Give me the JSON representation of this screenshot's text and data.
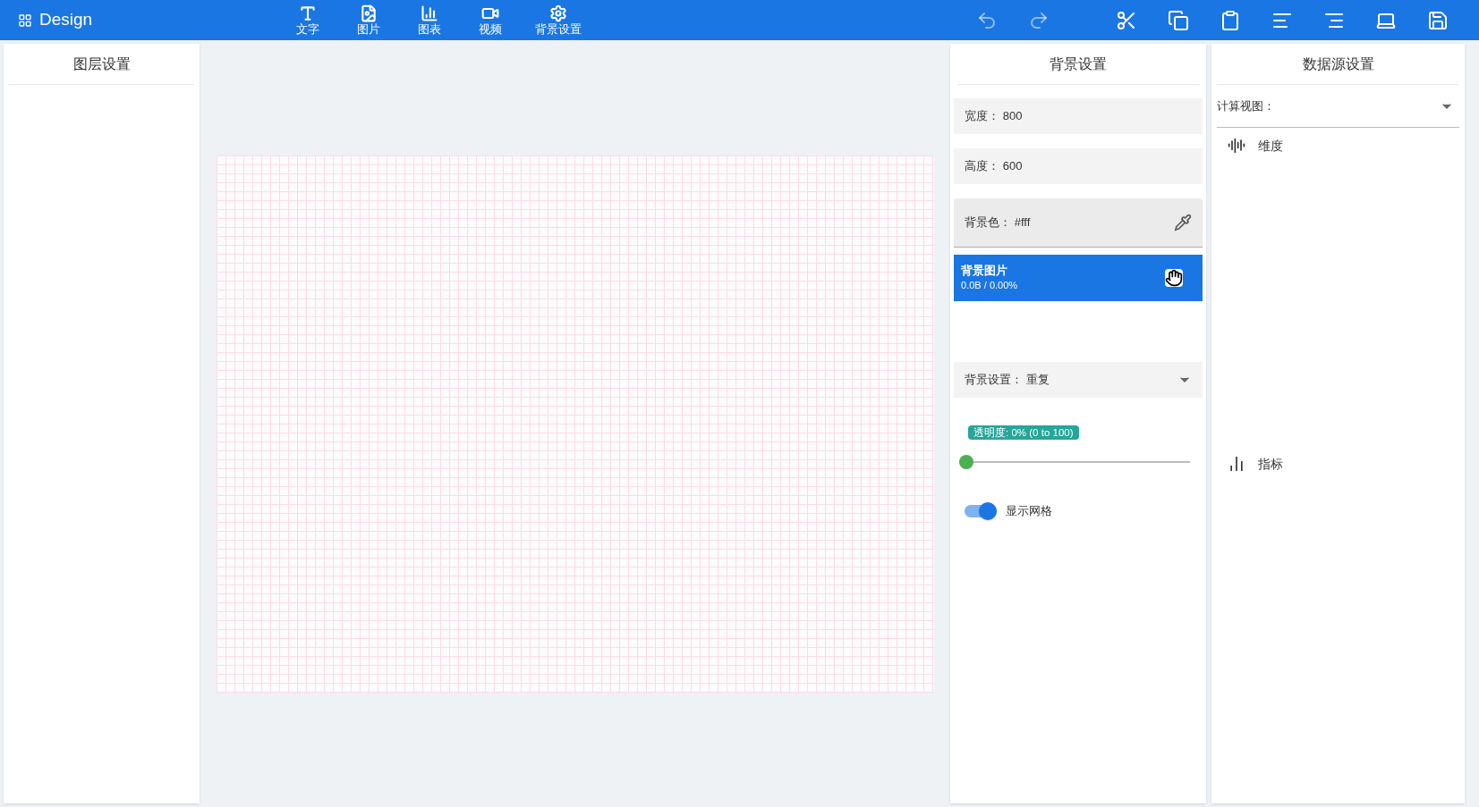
{
  "app": {
    "title": "Design"
  },
  "toolbar": [
    {
      "kind": "text",
      "label": "文字"
    },
    {
      "kind": "image",
      "label": "图片"
    },
    {
      "kind": "chart",
      "label": "图表"
    },
    {
      "kind": "video",
      "label": "视频"
    },
    {
      "kind": "settings",
      "label": "背景设置"
    }
  ],
  "actions": [
    {
      "kind": "undo",
      "disabled": true
    },
    {
      "kind": "redo",
      "disabled": true
    },
    {
      "kind": "cut",
      "disabled": false
    },
    {
      "kind": "copy",
      "disabled": false
    },
    {
      "kind": "paste",
      "disabled": false
    },
    {
      "kind": "align-left",
      "disabled": false
    },
    {
      "kind": "align-right",
      "disabled": false
    },
    {
      "kind": "preview",
      "disabled": false
    },
    {
      "kind": "save",
      "disabled": false
    }
  ],
  "layers_panel": {
    "title": "图层设置"
  },
  "background_panel": {
    "title": "背景设置",
    "fields": [
      {
        "kind": "input",
        "label": "宽度：",
        "value": "800"
      },
      {
        "kind": "input",
        "label": "高度：",
        "value": "600"
      },
      {
        "kind": "color",
        "label": "背景色：",
        "value": "#fff"
      }
    ],
    "upload": {
      "title": "背景图片",
      "progress": "0.0B / 0.00%",
      "level": 0
    },
    "repeat_select": {
      "label": "背景设置：",
      "value": "重复"
    },
    "opacity": {
      "label": "透明度: 0% (0 to 100)",
      "level": 0
    },
    "grid_toggle": {
      "label": "显示网格",
      "on": true
    }
  },
  "data_panel": {
    "title": "数据源设置",
    "select": {
      "label": "计算视图："
    },
    "sections": [
      {
        "kind": "dimension",
        "label": "维度"
      },
      {
        "kind": "measure",
        "label": "指标"
      }
    ]
  }
}
